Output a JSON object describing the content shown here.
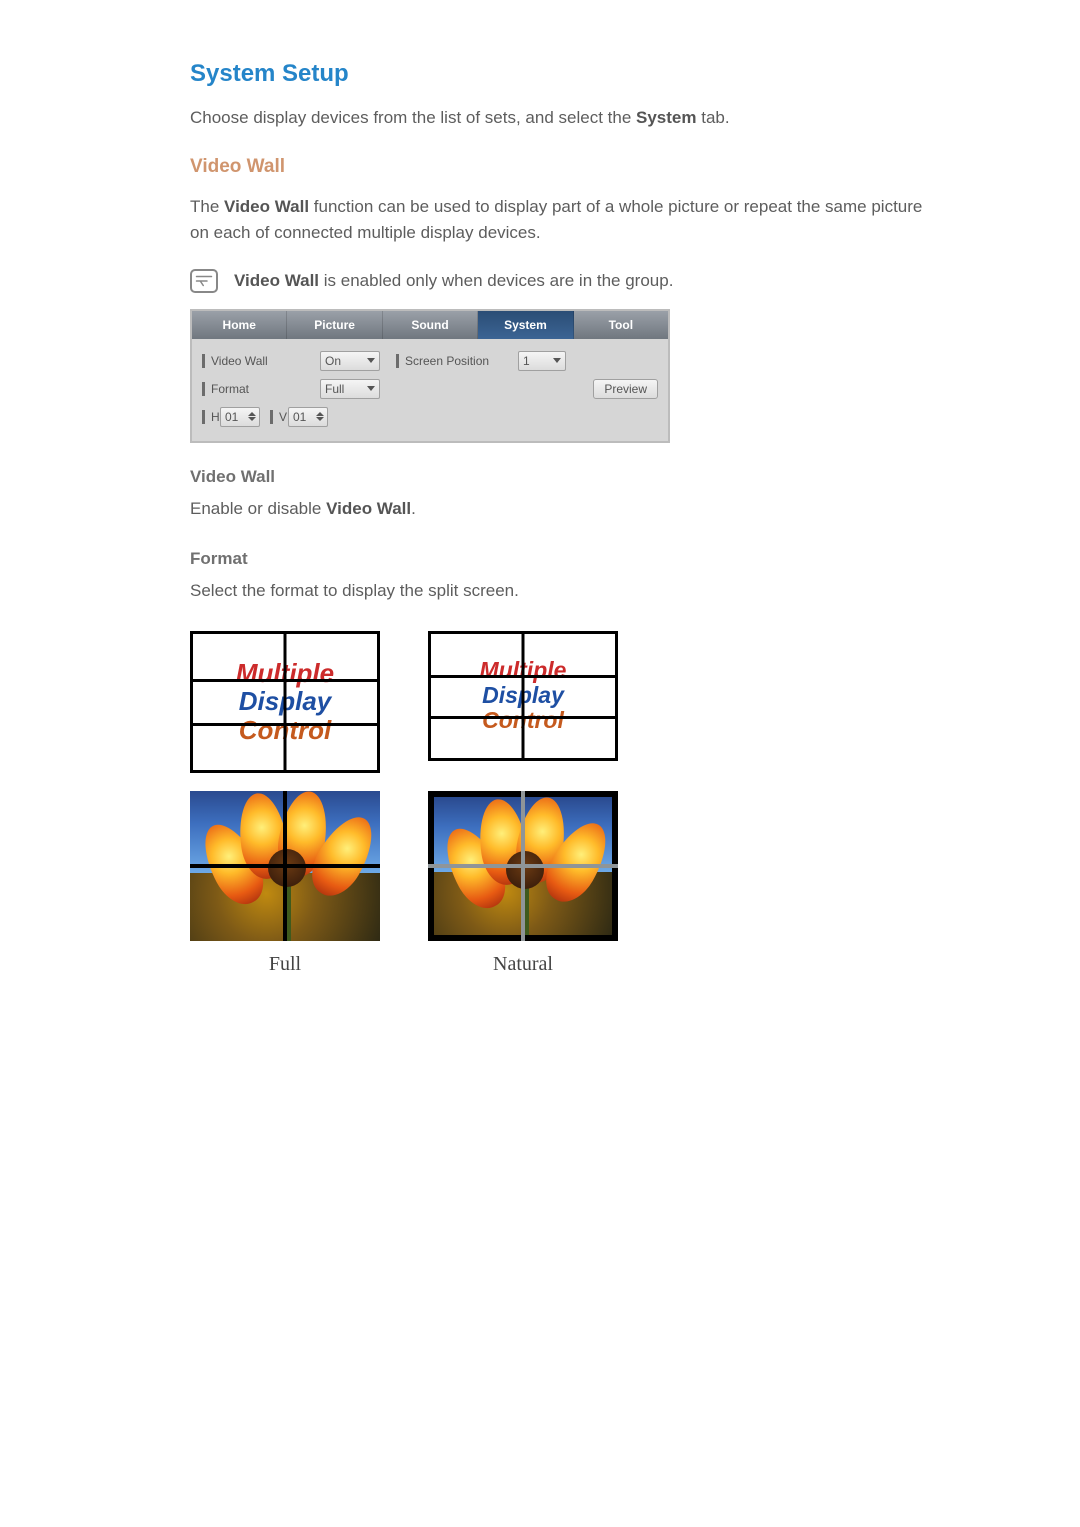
{
  "heading1": "System Setup",
  "intro_pre": "Choose display devices from the list of sets, and select the ",
  "intro_bold": "System",
  "intro_post": " tab.",
  "heading2": "Video Wall",
  "vw_desc_pre": "The ",
  "vw_desc_bold": "Video Wall",
  "vw_desc_post": " function can be used to display part of a whole picture or repeat the same picture on each of connected multiple display devices.",
  "note_bold": "Video Wall",
  "note_rest": " is enabled only when devices are in the group.",
  "tabs": [
    "Home",
    "Picture",
    "Sound",
    "System",
    "Tool"
  ],
  "panel": {
    "videowall_label": "Video Wall",
    "videowall_value": "On",
    "screenpos_label": "Screen Position",
    "screenpos_value": "1",
    "format_label": "Format",
    "format_value": "Full",
    "preview_label": "Preview",
    "h_label": "H",
    "h_value": "01",
    "v_label": "V",
    "v_value": "01"
  },
  "sub_vw": "Video Wall",
  "sub_vw_desc_pre": "Enable or disable ",
  "sub_vw_desc_bold": "Video Wall",
  "sub_vw_desc_post": ".",
  "sub_fmt": "Format",
  "sub_fmt_desc": "Select the format to display the split screen.",
  "logo_line1": "Multiple",
  "logo_line2": "Display",
  "logo_line3": "Control",
  "caption_full": "Full",
  "caption_natural": "Natural"
}
